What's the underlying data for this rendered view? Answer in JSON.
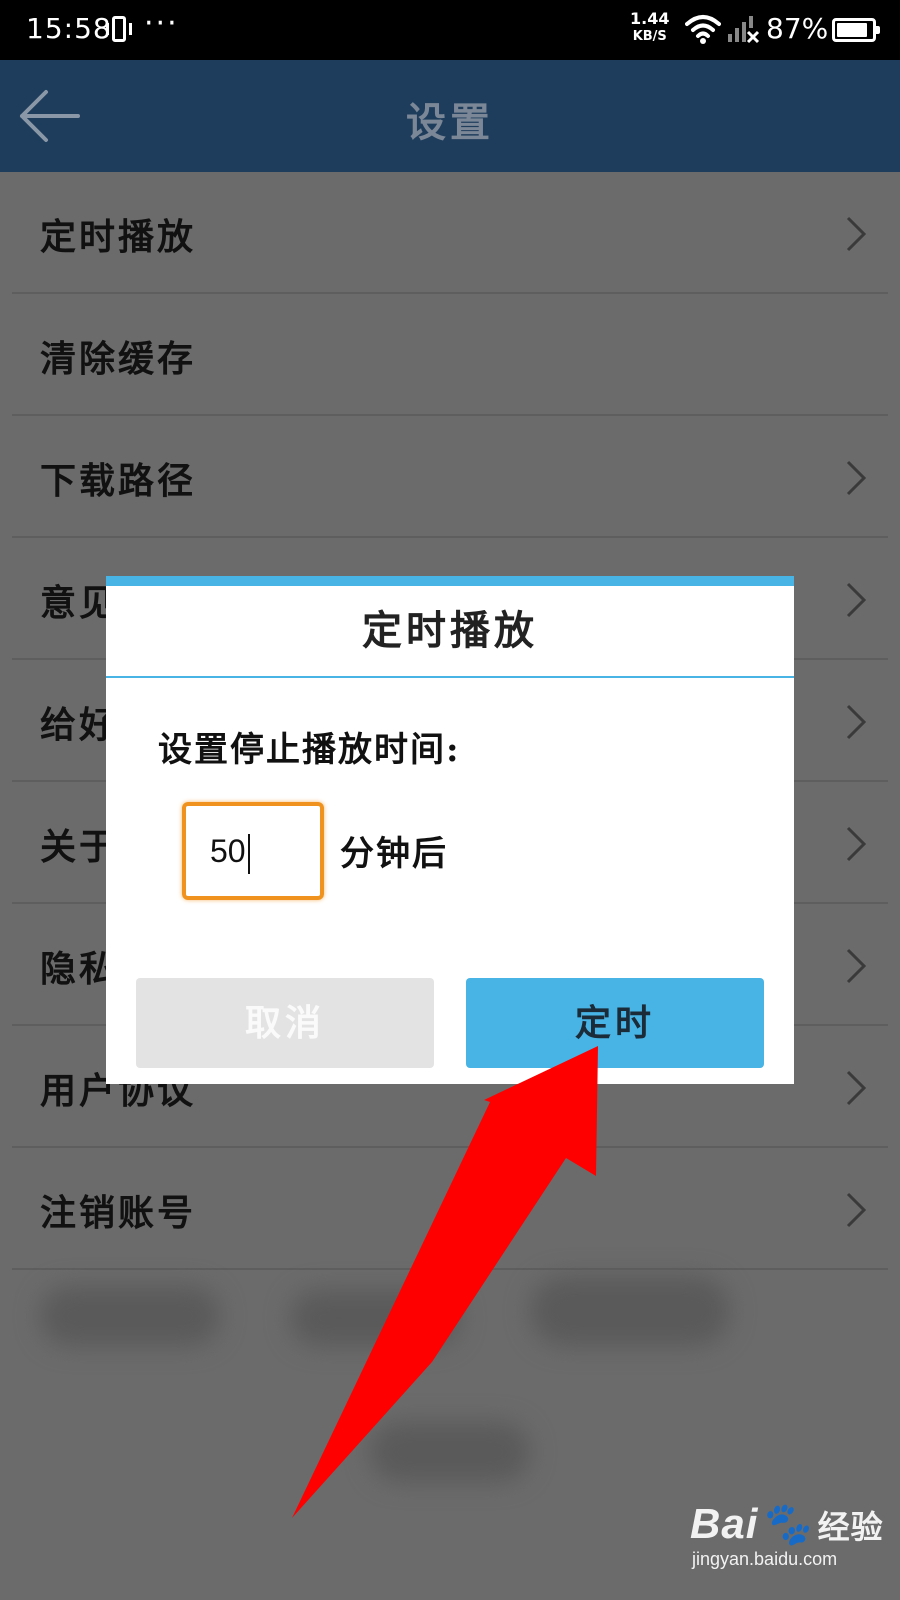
{
  "status_bar": {
    "time": "15:58",
    "dots": "···",
    "speed_value": "1.44",
    "speed_unit": "KB/S",
    "battery": "87%",
    "battery_level": 0.87,
    "icons": [
      "vibrate-icon",
      "wifi-icon",
      "signal-icon",
      "battery-icon"
    ]
  },
  "header": {
    "title": "设置",
    "back_icon": "arrow-left-icon"
  },
  "settings": {
    "items": [
      {
        "label": "定时播放",
        "has_chevron": true
      },
      {
        "label": "清除缓存",
        "has_chevron": false
      },
      {
        "label": "下载路径",
        "has_chevron": true
      },
      {
        "label": "意见",
        "has_chevron": true
      },
      {
        "label": "给好",
        "has_chevron": true
      },
      {
        "label": "关于",
        "has_chevron": true
      },
      {
        "label": "隐私",
        "has_chevron": true
      },
      {
        "label": "用户协议",
        "has_chevron": true
      },
      {
        "label": "注销账号",
        "has_chevron": true
      }
    ]
  },
  "dialog": {
    "title": "定时播放",
    "prompt": "设置停止播放时间:",
    "input_value": "50",
    "unit": "分钟后",
    "cancel_label": "取消",
    "confirm_label": "定时"
  },
  "colors": {
    "accent": "#48b4e6",
    "header_bg": "#1e3d5c",
    "input_border": "#f0921e",
    "annotation_arrow": "#ff0000"
  },
  "watermark": {
    "brand": "Bai",
    "brand_cn": "经验",
    "url": "jingyan.baidu.com"
  }
}
